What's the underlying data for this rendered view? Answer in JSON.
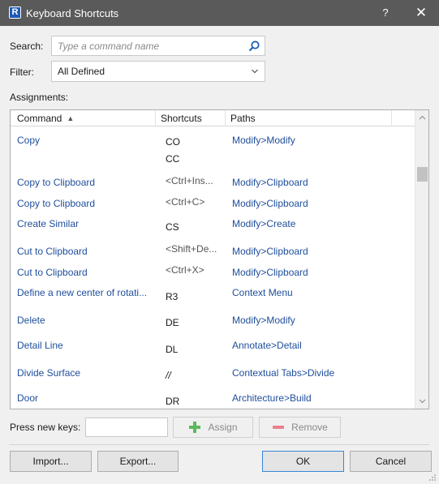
{
  "window": {
    "title": "Keyboard Shortcuts",
    "app_icon_letter": "R",
    "help_label": "?",
    "close_label": "✕"
  },
  "search": {
    "label": "Search:",
    "placeholder": "Type a command name",
    "icon": "search-icon"
  },
  "filter": {
    "label": "Filter:",
    "selected": "All Defined"
  },
  "assignments": {
    "label": "Assignments:",
    "columns": {
      "command": "Command",
      "shortcuts": "Shortcuts",
      "paths": "Paths"
    },
    "sort_indicator": "▲",
    "rows": [
      {
        "command": "Copy",
        "shortcut": "CO",
        "shortcut2": "CC",
        "path": "Modify>Modify"
      },
      {
        "command": "Copy to Clipboard",
        "shortcut": "<Ctrl+Ins...",
        "path": "Modify>Clipboard"
      },
      {
        "command": "Copy to Clipboard",
        "shortcut": "<Ctrl+C>",
        "path": "Modify>Clipboard"
      },
      {
        "command": "Create Similar",
        "shortcut": "CS",
        "path": "Modify>Create"
      },
      {
        "command": "Cut to Clipboard",
        "shortcut": "<Shift+De...",
        "path": "Modify>Clipboard"
      },
      {
        "command": "Cut to Clipboard",
        "shortcut": "<Ctrl+X>",
        "path": "Modify>Clipboard"
      },
      {
        "command": "Define a new center of rotati...",
        "shortcut": "R3",
        "path": "Context Menu"
      },
      {
        "command": "Delete",
        "shortcut": "DE",
        "path": "Modify>Modify"
      },
      {
        "command": "Detail Line",
        "shortcut": "DL",
        "path": "Annotate>Detail"
      },
      {
        "command": "Divide Surface",
        "shortcut": "//",
        "path": "Contextual Tabs>Divide"
      },
      {
        "command": "Door",
        "shortcut": "DR",
        "path": "Architecture>Build"
      }
    ]
  },
  "press_keys": {
    "label": "Press new keys:",
    "value": ""
  },
  "buttons": {
    "assign": "Assign",
    "remove": "Remove",
    "import": "Import...",
    "export": "Export...",
    "ok": "OK",
    "cancel": "Cancel"
  },
  "colors": {
    "titlebar": "#5a5a5a",
    "link_blue": "#1f4e9b",
    "assign_green": "#5cb85c",
    "remove_red": "#e8808a",
    "focus_blue": "#3a84d6"
  }
}
